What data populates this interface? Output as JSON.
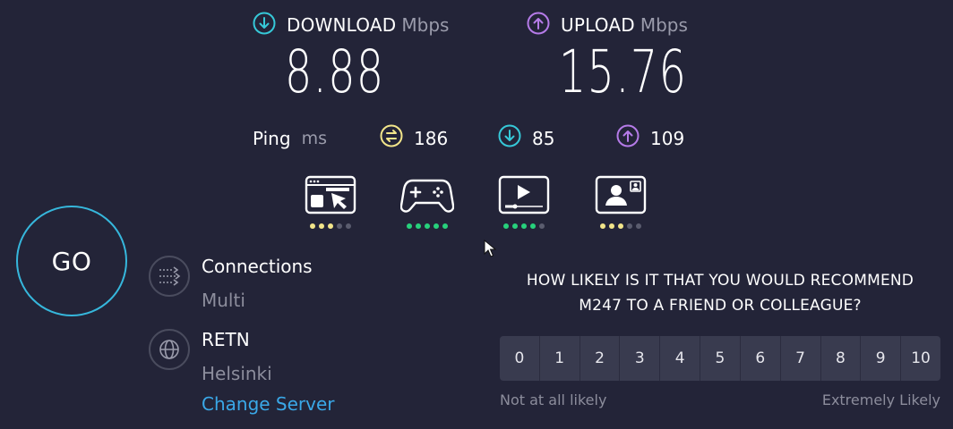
{
  "download": {
    "label": "DOWNLOAD",
    "unit": "Mbps",
    "value": "8.88"
  },
  "upload": {
    "label": "UPLOAD",
    "unit": "Mbps",
    "value": "15.76"
  },
  "ping": {
    "label": "Ping",
    "unit": "ms",
    "idle": "186",
    "down": "85",
    "up": "109"
  },
  "quality": {
    "browsing": [
      "yellow",
      "yellow",
      "yellow",
      "off",
      "off"
    ],
    "gaming": [
      "green",
      "green",
      "green",
      "green",
      "green"
    ],
    "streaming": [
      "green",
      "green",
      "green",
      "green",
      "off"
    ],
    "video_chat": [
      "yellow",
      "yellow",
      "yellow",
      "off",
      "off"
    ]
  },
  "go_label": "GO",
  "connections": {
    "title": "Connections",
    "value": "Multi"
  },
  "server": {
    "name": "RETN",
    "location": "Helsinki",
    "change": "Change Server"
  },
  "survey": {
    "line1": "HOW LIKELY IS IT THAT YOU WOULD RECOMMEND",
    "line2": "M247 TO A FRIEND OR COLLEAGUE?",
    "scale": [
      "0",
      "1",
      "2",
      "3",
      "4",
      "5",
      "6",
      "7",
      "8",
      "9",
      "10"
    ],
    "low_label": "Not at all likely",
    "high_label": "Extremely Likely"
  },
  "colors": {
    "accent": "#36b7dc",
    "upload": "#b57be8",
    "ping": "#f2e58a",
    "link": "#3aa8e8"
  }
}
